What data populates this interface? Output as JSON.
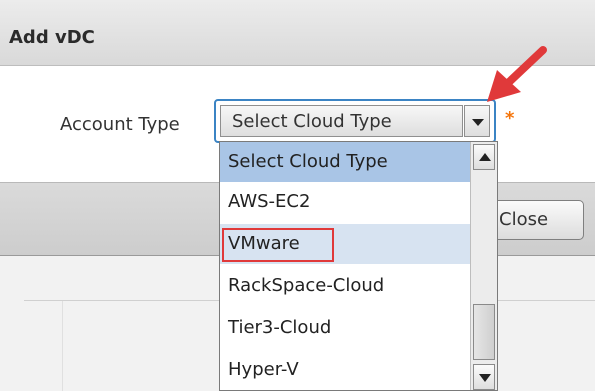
{
  "dialog": {
    "title": "Add vDC",
    "field_label": "Account Type",
    "select_value": "Select Cloud Type",
    "required_mark": "*",
    "close_label": "Close"
  },
  "dropdown": {
    "options": [
      {
        "label": "Select Cloud Type",
        "state": "selected"
      },
      {
        "label": "AWS-EC2",
        "state": "normal"
      },
      {
        "label": "VMware",
        "state": "hovered-highlighted"
      },
      {
        "label": "RackSpace-Cloud",
        "state": "normal"
      },
      {
        "label": "Tier3-Cloud",
        "state": "normal"
      },
      {
        "label": "Hyper-V",
        "state": "normal"
      }
    ]
  },
  "colors": {
    "selected_option": "#a9c5e6",
    "hovered_option": "#d7e3f1",
    "annotation_red": "#e0393a",
    "required_orange": "#f5750a",
    "focus_border": "#3b84c4"
  },
  "icons": {
    "dropdown_toggle": "chevron-down-icon",
    "scroll_up": "scroll-up-icon",
    "scroll_down": "scroll-down-icon",
    "annotation": "red-arrow-icon"
  }
}
